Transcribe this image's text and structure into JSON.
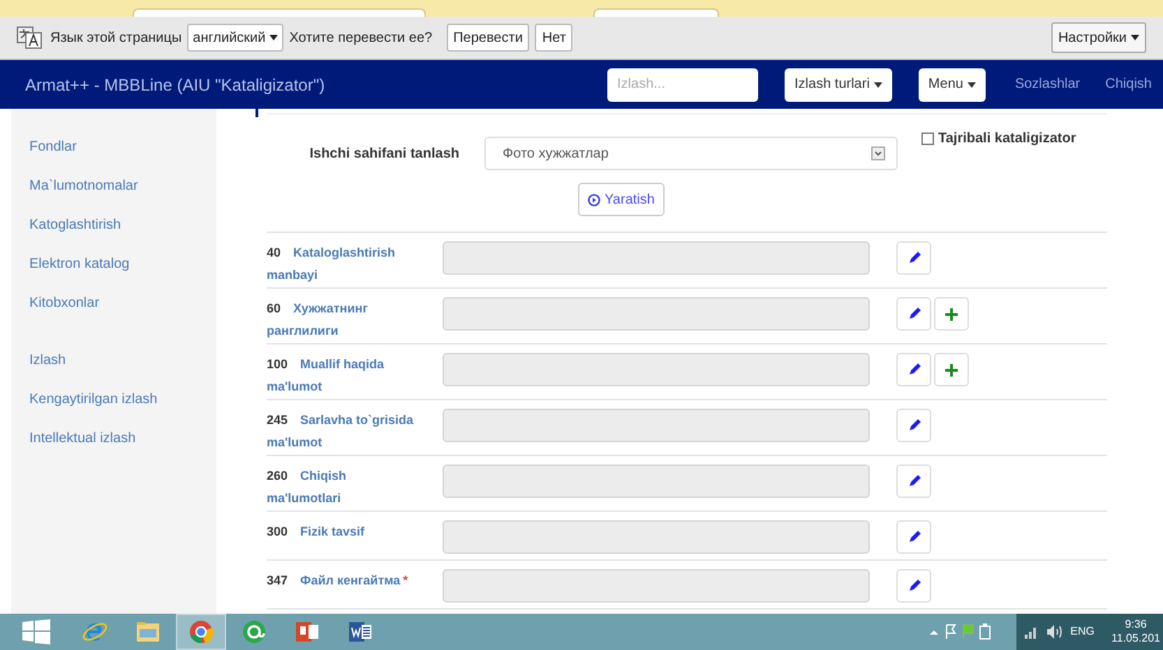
{
  "translate_bar": {
    "page_language_label": "Язык этой страницы",
    "language": "английский",
    "question": "Хотите перевести ее?",
    "translate_button": "Перевести",
    "no_button": "Нет",
    "settings_button": "Настройки"
  },
  "navbar": {
    "title": "Armat++ - MBBLine (AIU \"Kataligizator\")",
    "search_placeholder": "Izlash...",
    "search_types_button": "Izlash turlari",
    "menu_button": "Menu",
    "links": [
      "Sozlashlar",
      "Chiqish"
    ]
  },
  "sidebar": {
    "groups": [
      [
        "Fondlar",
        "Ma`lumotnomalar",
        "Katoglashtirish",
        "Elektron katalog",
        "Kitobxonlar"
      ],
      [
        "Izlash",
        "Kengaytirilgan izlash",
        "Intellektual izlash"
      ]
    ]
  },
  "form": {
    "worksheet_label": "Ishchi sahifani tanlash",
    "worksheet_value": "Фото хужжатлар",
    "experienced_label": "Tajribali kataligizator",
    "experienced_checked": false,
    "create_button": "Yaratish",
    "fields": [
      {
        "tag": "40",
        "label": "Kataloglashtirish manbayi",
        "add": false
      },
      {
        "tag": "60",
        "label": "Хужжатнинг ранглилиги",
        "add": true
      },
      {
        "tag": "100",
        "label": "Muallif haqida ma'lumot",
        "add": true
      },
      {
        "tag": "245",
        "label": "Sarlavha to`grisida ma'lumot",
        "add": false
      },
      {
        "tag": "260",
        "label": "Chiqish ma'lumotlari",
        "add": false
      },
      {
        "tag": "300",
        "label": "Fizik tavsif",
        "add": false
      },
      {
        "tag": "347",
        "label": "Файл кенгайтма",
        "required_mark": "*",
        "add": false
      }
    ]
  },
  "taskbar": {
    "apps": [
      {
        "kind": "ie",
        "selected": false
      },
      {
        "kind": "folder",
        "selected": false
      },
      {
        "kind": "chrome",
        "selected": true
      },
      {
        "kind": "at",
        "selected": false
      },
      {
        "kind": "powerpoint",
        "selected": false
      },
      {
        "kind": "word",
        "selected": false
      }
    ],
    "language": "ENG",
    "time": "9:36",
    "date": "11.05.201"
  }
}
